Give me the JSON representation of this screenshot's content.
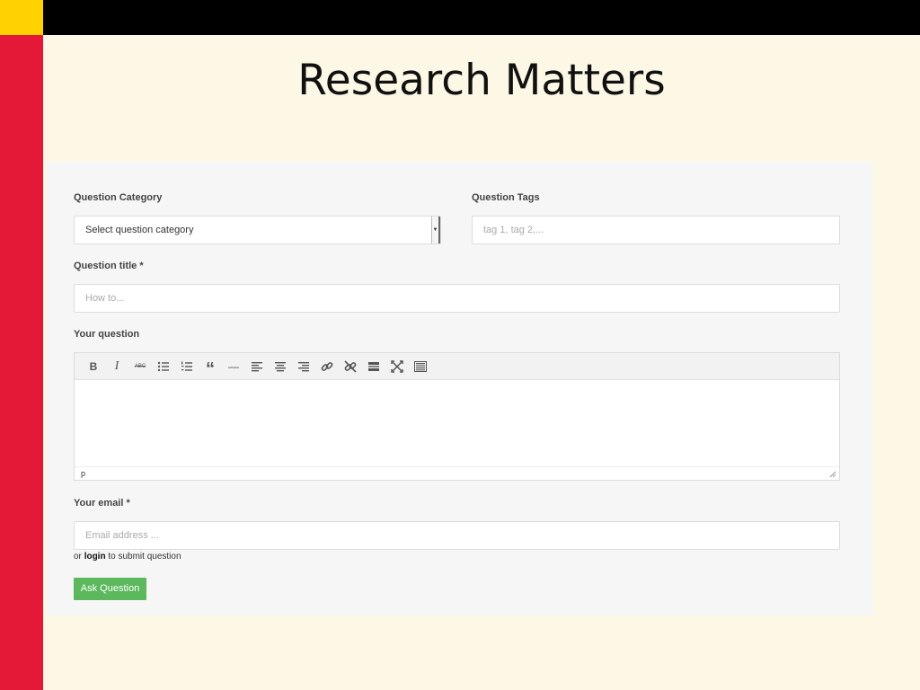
{
  "slide": {
    "title": "Research Matters"
  },
  "form": {
    "category": {
      "label": "Question Category",
      "selected": "Select question category"
    },
    "tags": {
      "label": "Question Tags",
      "placeholder": "tag 1, tag 2,..."
    },
    "title_field": {
      "label": "Question title *",
      "placeholder": "How to..."
    },
    "question": {
      "label": "Your question",
      "toolbar": [
        {
          "icon": "bold-icon",
          "glyph": "B"
        },
        {
          "icon": "italic-icon",
          "glyph": "I"
        },
        {
          "icon": "strikethrough-icon",
          "glyph": "ABC"
        },
        {
          "icon": "bullet-list-icon"
        },
        {
          "icon": "numbered-list-icon"
        },
        {
          "icon": "blockquote-icon",
          "glyph": "“"
        },
        {
          "icon": "horizontal-rule-icon",
          "glyph": "—"
        },
        {
          "icon": "align-left-icon"
        },
        {
          "icon": "align-center-icon"
        },
        {
          "icon": "align-right-icon"
        },
        {
          "icon": "insert-link-icon"
        },
        {
          "icon": "remove-link-icon"
        },
        {
          "icon": "read-more-icon"
        },
        {
          "icon": "fullscreen-icon"
        },
        {
          "icon": "toolbar-toggle-icon"
        }
      ],
      "status_path": "p"
    },
    "email": {
      "label": "Your email *",
      "placeholder": "Email address ..."
    },
    "login_note": {
      "prefix": "or",
      "link": "login",
      "suffix": "to submit question"
    },
    "submit_label": "Ask Question"
  },
  "colors": {
    "background": "#fdf7e6",
    "top_bar": "#000000",
    "corner": "#ffd200",
    "side_bar": "#e31937",
    "submit": "#5cb85c"
  }
}
